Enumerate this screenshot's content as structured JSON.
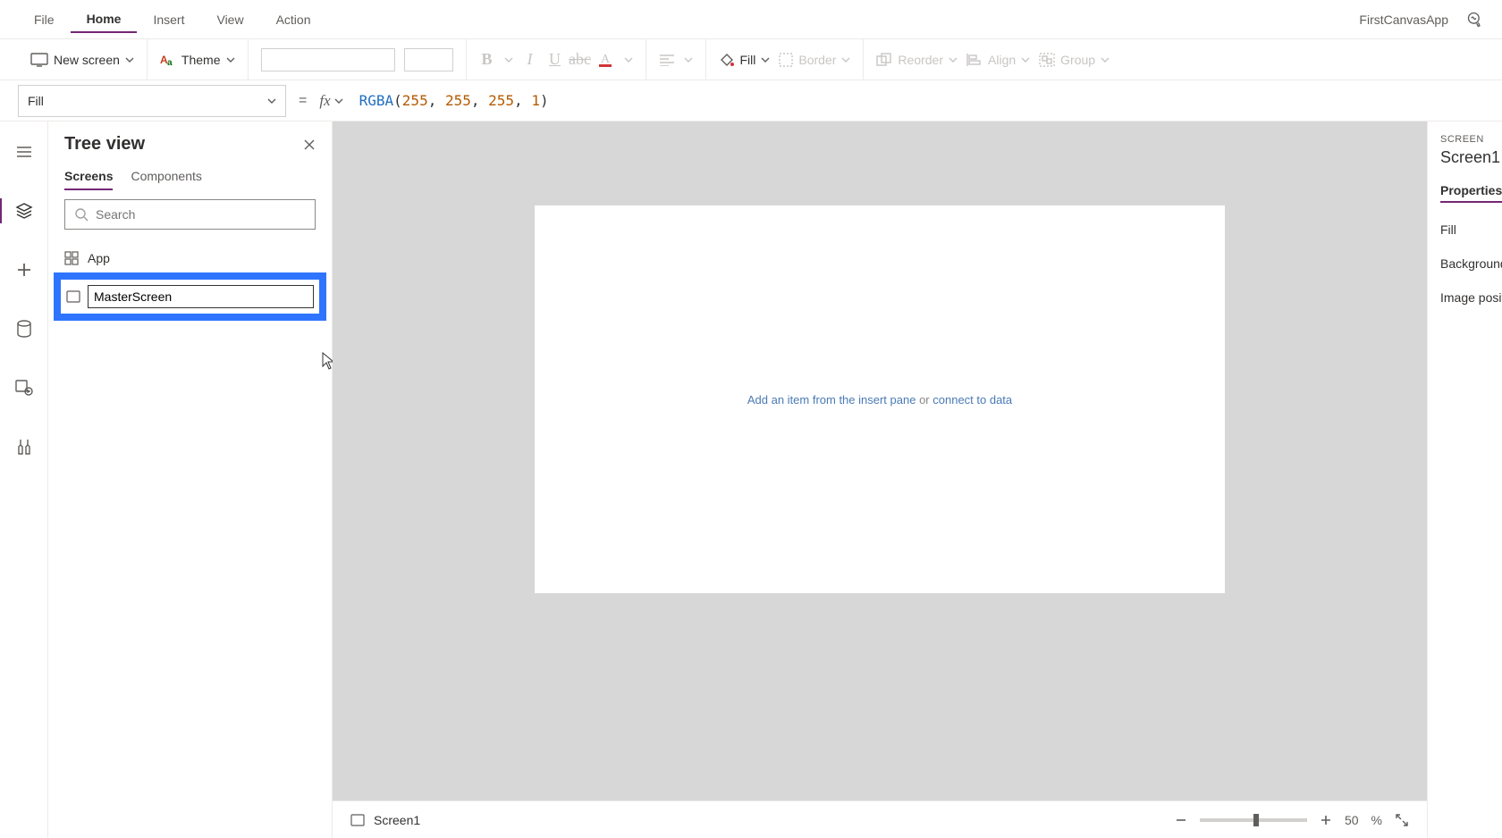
{
  "menu": {
    "items": [
      "File",
      "Home",
      "Insert",
      "View",
      "Action"
    ],
    "active": "Home",
    "app_name": "FirstCanvasApp"
  },
  "ribbon": {
    "new_screen": "New screen",
    "theme": "Theme",
    "fill": "Fill",
    "border": "Border",
    "reorder": "Reorder",
    "align": "Align",
    "group": "Group"
  },
  "formula": {
    "property": "Fill",
    "fx": "fx",
    "fn": "RGBA",
    "args": [
      "255",
      "255",
      "255",
      "1"
    ]
  },
  "tree": {
    "title": "Tree view",
    "tabs": [
      "Screens",
      "Components"
    ],
    "active_tab": "Screens",
    "search_placeholder": "Search",
    "app_label": "App",
    "rename_value": "MasterScreen"
  },
  "canvas": {
    "hint_left": "Add an item from the insert pane",
    "hint_mid": " or ",
    "hint_right": "connect to data",
    "status_name": "Screen1"
  },
  "zoom": {
    "value": "50",
    "unit": "%"
  },
  "props": {
    "heading": "SCREEN",
    "name": "Screen1",
    "tab": "Properties",
    "rows": [
      "Fill",
      "Background",
      "Image posit"
    ]
  }
}
